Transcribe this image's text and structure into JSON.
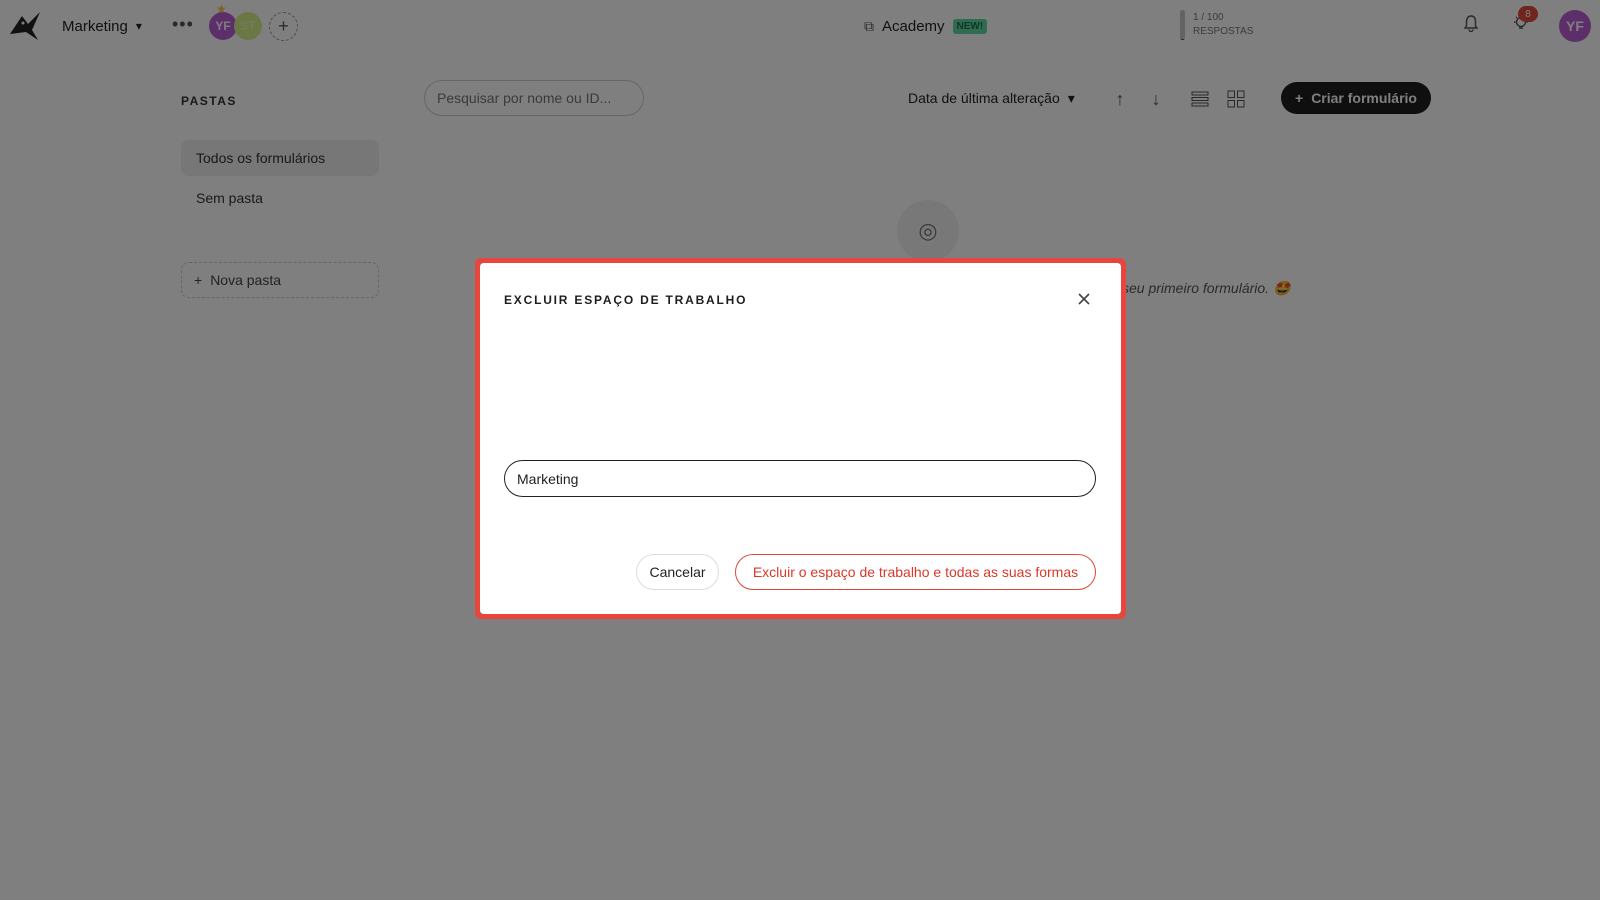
{
  "header": {
    "workspace_name": "Marketing",
    "more_label": "•••",
    "avatars": [
      "YF",
      "ST"
    ],
    "academy_label": "Academy",
    "academy_badge": "NEW!",
    "responses_count": "1 / 100",
    "responses_label": "RESPOSTAS",
    "responses_fraction": 0.01,
    "notifications_count": "8",
    "user_initials": "YF"
  },
  "sidebar": {
    "title": "PASTAS",
    "items": [
      {
        "label": "Todos os formulários",
        "active": true
      },
      {
        "label": "Sem pasta",
        "active": false
      }
    ],
    "new_folder_label": "Nova pasta"
  },
  "toolbar": {
    "search_placeholder": "Pesquisar por nome ou ID...",
    "sort_label": "Data de última alteração",
    "create_label": "Criar formulário"
  },
  "empty_state": {
    "text": "seu primeiro formulário. 🤩"
  },
  "modal": {
    "title": "EXCLUIR ESPAÇO DE TRABALHO",
    "input_value": "Marketing",
    "cancel_label": "Cancelar",
    "delete_label": "Excluir o espaço de trabalho e todas as suas formas"
  },
  "colors": {
    "accent_dark": "#1e1e1e",
    "danger": "#e8463c",
    "avatar": "#b95fd6",
    "new_badge": "#5fd9a5"
  },
  "icons": {
    "logo": "bird-logo-icon",
    "close": "close-icon",
    "bell": "bell-icon",
    "bulb": "lightbulb-icon",
    "list_view": "list-view-icon",
    "grid_view": "grid-view-icon"
  }
}
